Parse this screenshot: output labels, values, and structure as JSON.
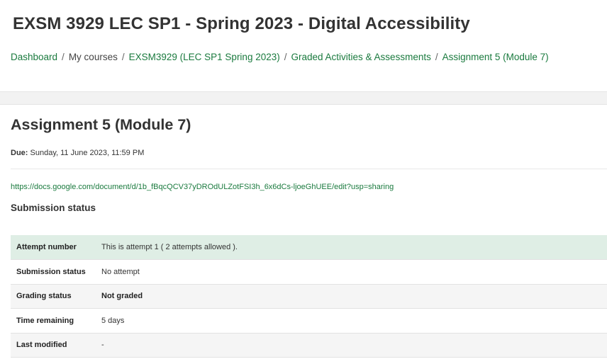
{
  "header": {
    "course_title": "EXSM 3929 LEC SP1 - Spring 2023 - Digital Accessibility",
    "breadcrumb": [
      {
        "label": "Dashboard",
        "link": true
      },
      {
        "label": "My courses",
        "link": false
      },
      {
        "label": "EXSM3929 (LEC SP1 Spring 2023)",
        "link": true
      },
      {
        "label": "Graded Activities & Assessments",
        "link": true
      },
      {
        "label": "Assignment 5 (Module 7)",
        "link": true
      }
    ],
    "separator": "/"
  },
  "main": {
    "title": "Assignment 5 (Module 7)",
    "due_label": "Due:",
    "due_value": "Sunday, 11 June 2023, 11:59 PM",
    "doc_link": "https://docs.google.com/document/d/1b_fBqcQCV37yDROdULZotFSI3h_6x6dCs-ljoeGhUEE/edit?usp=sharing",
    "section_heading": "Submission status",
    "status_rows": [
      {
        "label": "Attempt number",
        "value": "This is attempt 1 ( 2 attempts allowed )."
      },
      {
        "label": "Submission status",
        "value": "No attempt"
      },
      {
        "label": "Grading status",
        "value": "Not graded"
      },
      {
        "label": "Time remaining",
        "value": "5 days"
      },
      {
        "label": "Last modified",
        "value": "-"
      }
    ]
  },
  "colors": {
    "link": "#1a7a3e",
    "attempt_row_bg": "#dfeee5",
    "page_bg": "#f2f2f2"
  }
}
